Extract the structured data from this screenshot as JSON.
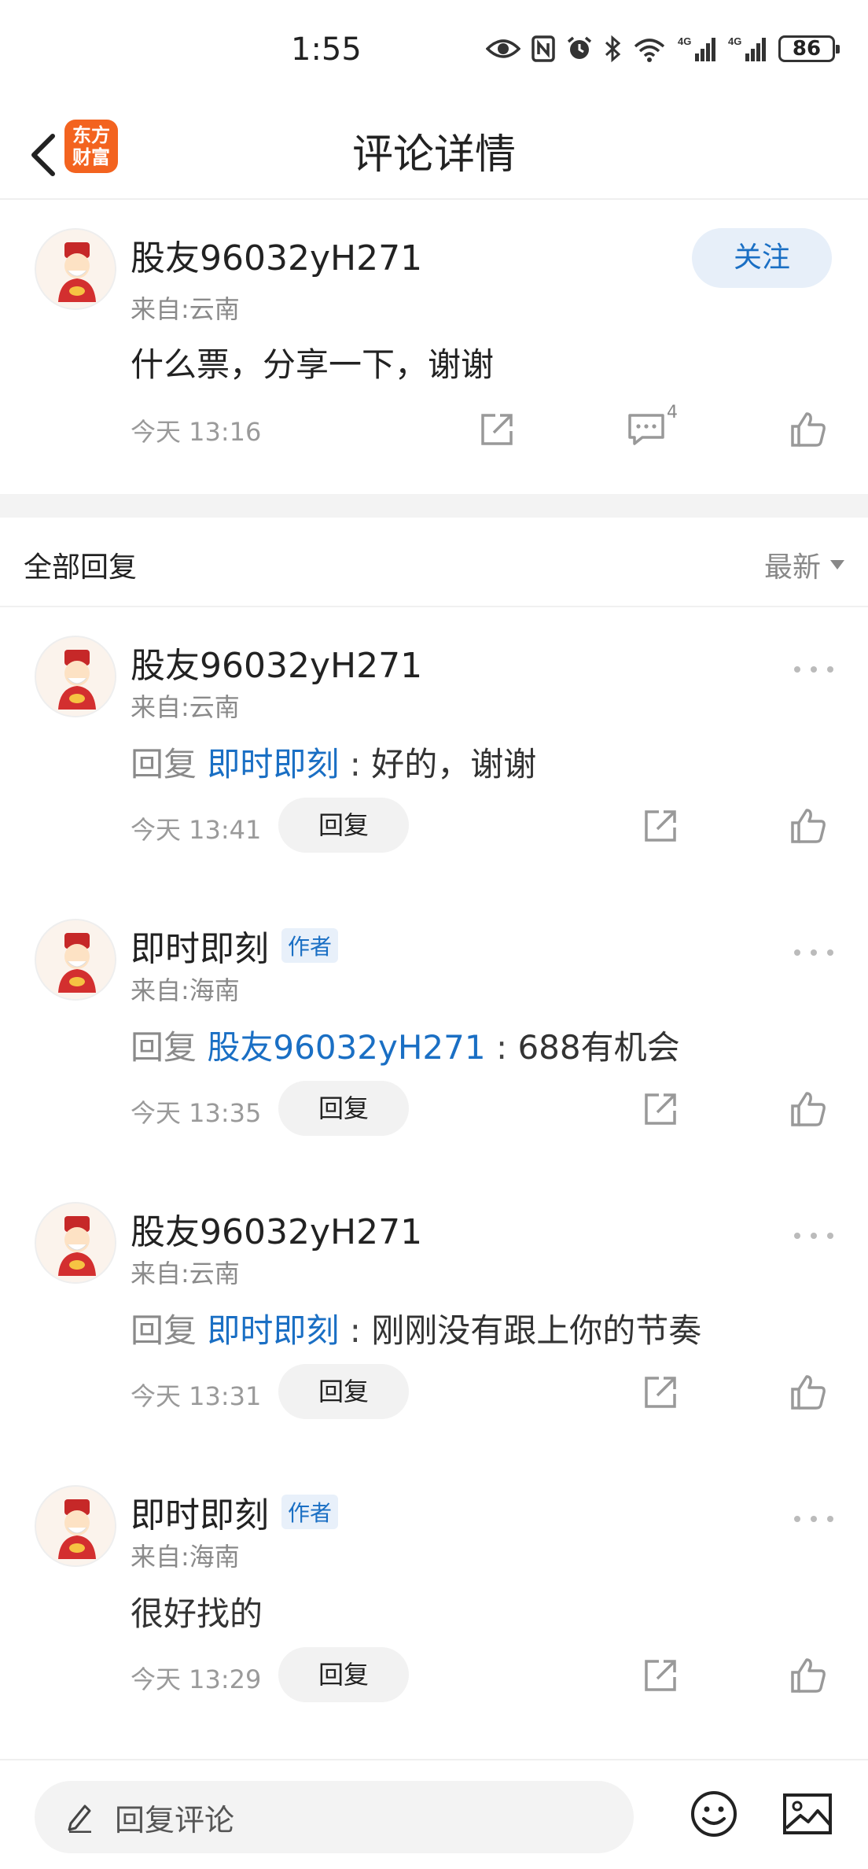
{
  "status_bar": {
    "time": "1:55",
    "battery": "86",
    "signal_label_1": "4G",
    "signal_label_2": "4G"
  },
  "header": {
    "title": "评论详情",
    "logo_text_line1": "东方",
    "logo_text_line2": "财富"
  },
  "main_post": {
    "username": "股友96032yH271",
    "location": "来自:云南",
    "content": "什么票，分享一下，谢谢",
    "time": "今天 13:16",
    "follow_label": "关注",
    "comment_count": "4"
  },
  "replies_section": {
    "title": "全部回复",
    "sort_label": "最新"
  },
  "replies": [
    {
      "username": "股友96032yH271",
      "is_author": false,
      "location": "来自:云南",
      "reply_prefix": "回复",
      "reply_target": "即时即刻",
      "separator": " : ",
      "content": "好的，谢谢",
      "time": "今天 13:41",
      "reply_label": "回复"
    },
    {
      "username": "即时即刻",
      "is_author": true,
      "author_badge": "作者",
      "location": "来自:海南",
      "reply_prefix": "回复",
      "reply_target": "股友96032yH271",
      "separator": " : ",
      "content": "688有机会",
      "time": "今天 13:35",
      "reply_label": "回复"
    },
    {
      "username": "股友96032yH271",
      "is_author": false,
      "location": "来自:云南",
      "reply_prefix": "回复",
      "reply_target": "即时即刻",
      "separator": " : ",
      "content": "刚刚没有跟上你的节奏",
      "time": "今天 13:31",
      "reply_label": "回复"
    },
    {
      "username": "即时即刻",
      "is_author": true,
      "author_badge": "作者",
      "location": "来自:海南",
      "content": "很好找的",
      "time": "今天 13:29",
      "reply_label": "回复"
    }
  ],
  "bottom_bar": {
    "input_placeholder": "回复评论"
  },
  "colors": {
    "accent_blue": "#1a6fc4",
    "logo_orange": "#f3631f",
    "follow_bg": "#e7eff9"
  }
}
